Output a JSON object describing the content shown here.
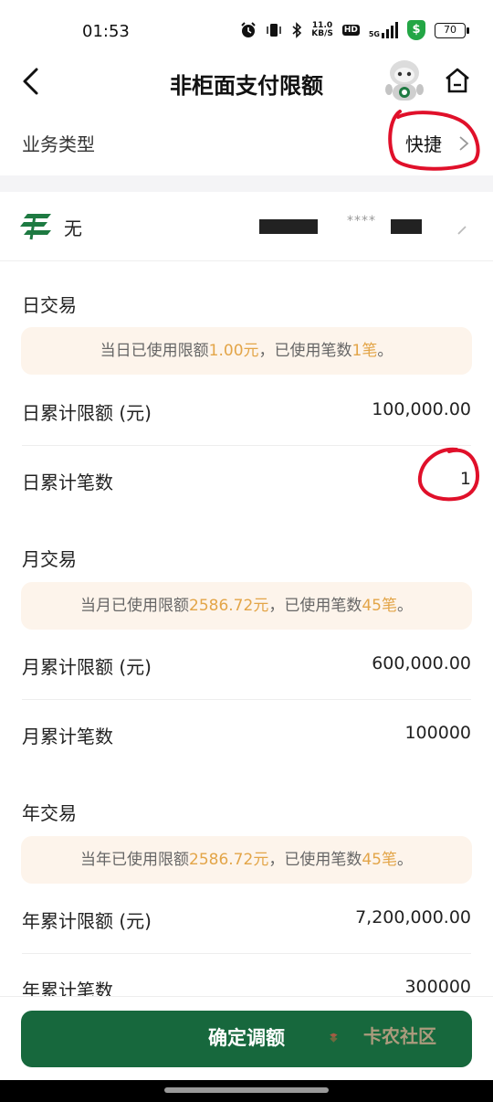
{
  "status_bar": {
    "time": "01:53",
    "net_speed_value": "11.0",
    "net_speed_unit": "KB/S",
    "hd_badge": "HD",
    "signal_label": "5G",
    "shield_symbol": "$",
    "battery": "70"
  },
  "header": {
    "title": "非柜面支付限额"
  },
  "business_type": {
    "label": "业务类型",
    "value": "快捷"
  },
  "account": {
    "name": "无",
    "masked_number": "****"
  },
  "daily": {
    "title": "日交易",
    "notice_prefix": "当日已使用限额",
    "notice_amount": "1.00元",
    "notice_mid": "，已使用笔数",
    "notice_count": "1笔",
    "notice_suffix": "。",
    "limit_label": "日累计限额 (元)",
    "limit_value": "100,000.00",
    "count_label": "日累计笔数",
    "count_value": "1"
  },
  "monthly": {
    "title": "月交易",
    "notice_prefix": "当月已使用限额",
    "notice_amount": "2586.72元",
    "notice_mid": "，已使用笔数",
    "notice_count": "45笔",
    "notice_suffix": "。",
    "limit_label": "月累计限额 (元)",
    "limit_value": "600,000.00",
    "count_label": "月累计笔数",
    "count_value": "100000"
  },
  "yearly": {
    "title": "年交易",
    "notice_prefix": "当年已使用限额",
    "notice_amount": "2586.72元",
    "notice_mid": "，已使用笔数",
    "notice_count": "45笔",
    "notice_suffix": "。",
    "limit_label": "年累计限额 (元)",
    "limit_value": "7,200,000.00",
    "count_label": "年累计笔数",
    "count_value": "300000"
  },
  "footer": {
    "confirm_label": "确定调额",
    "watermark": "卡农社区"
  },
  "colors": {
    "brand_green": "#17683d",
    "highlight_orange": "#e3a548",
    "notice_bg": "#fdf4eb",
    "annotation_red": "#e0102a"
  }
}
